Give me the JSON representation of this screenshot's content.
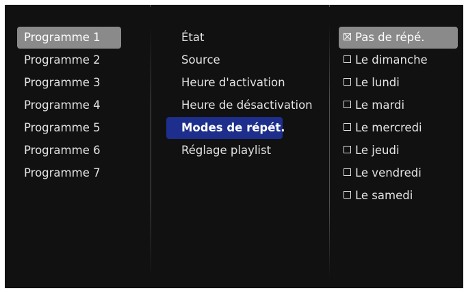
{
  "programs": [
    {
      "label": "Programme 1"
    },
    {
      "label": "Programme 2"
    },
    {
      "label": "Programme 3"
    },
    {
      "label": "Programme 4"
    },
    {
      "label": "Programme 5"
    },
    {
      "label": "Programme 6"
    },
    {
      "label": "Programme 7"
    }
  ],
  "settings": [
    {
      "label": "État"
    },
    {
      "label": "Source"
    },
    {
      "label": "Heure d'activation"
    },
    {
      "label": "Heure de désactivation"
    },
    {
      "label": "Modes de répét."
    },
    {
      "label": "Réglage playlist"
    }
  ],
  "repeat_options": [
    {
      "label": "Pas de répé.",
      "checked": true
    },
    {
      "label": "Le dimanche",
      "checked": false
    },
    {
      "label": "Le lundi",
      "checked": false
    },
    {
      "label": "Le mardi",
      "checked": false
    },
    {
      "label": "Le mercredi",
      "checked": false
    },
    {
      "label": "Le jeudi",
      "checked": false
    },
    {
      "label": "Le vendredi",
      "checked": false
    },
    {
      "label": "Le samedi",
      "checked": false
    }
  ],
  "selection": {
    "program": "Programme 1",
    "setting": "Modes de répét.",
    "option": "Pas de répé."
  },
  "colors": {
    "background": "#111111",
    "highlight_grey": "#8a8a8a",
    "highlight_blue": "#1d2e8c",
    "text": "#e3e3e3"
  }
}
